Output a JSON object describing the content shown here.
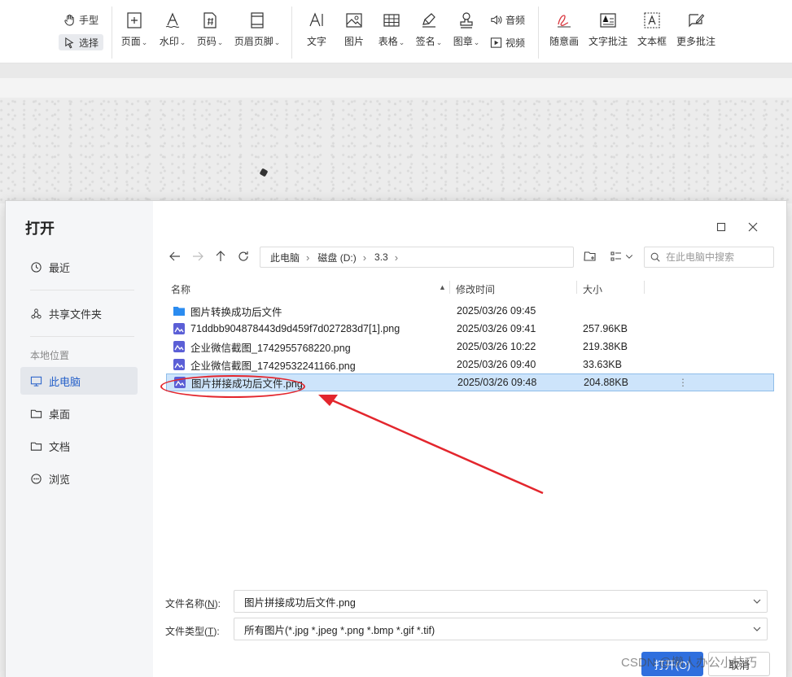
{
  "toolbar": {
    "hand_label": "手型",
    "select_label": "选择",
    "page_label": "页面",
    "watermark_label": "水印",
    "pagenum_label": "页码",
    "headerfooter_label": "页眉页脚",
    "text_label": "文字",
    "image_label": "图片",
    "table_label": "表格",
    "sign_label": "签名",
    "stamp_label": "图章",
    "audio_label": "音频",
    "video_label": "视频",
    "freehand_label": "随意画",
    "textnote_label": "文字批注",
    "textbox_label": "文本框",
    "morenote_label": "更多批注"
  },
  "dialog": {
    "title": "打开",
    "sidebar": {
      "recent": "最近",
      "shared": "共享文件夹",
      "local_section": "本地位置",
      "this_pc": "此电脑",
      "desktop": "桌面",
      "documents": "文档",
      "browse": "浏览"
    },
    "breadcrumb": [
      "此电脑",
      "磁盘 (D:)",
      "3.3"
    ],
    "search_placeholder": "在此电脑中搜索",
    "columns": {
      "name": "名称",
      "modified": "修改时间",
      "size": "大小"
    },
    "files": [
      {
        "name": "图片转换成功后文件",
        "date": "2025/03/26 09:45",
        "size": "",
        "type": "folder"
      },
      {
        "name": "71ddbb904878443d9d459f7d027283d7[1].png",
        "date": "2025/03/26 09:41",
        "size": "257.96KB",
        "type": "image"
      },
      {
        "name": "企业微信截图_1742955768220.png",
        "date": "2025/03/26 10:22",
        "size": "219.38KB",
        "type": "image"
      },
      {
        "name": "企业微信截图_17429532241166.png",
        "date": "2025/03/26 09:40",
        "size": "33.63KB",
        "type": "image"
      },
      {
        "name": "图片拼接成功后文件.png",
        "date": "2025/03/26 09:48",
        "size": "204.88KB",
        "type": "image",
        "selected": true
      }
    ],
    "more_icon_text": "⋮",
    "filename_label": "文件名称(",
    "filename_key": "N",
    "filename_label_end": "):",
    "filename_value": "图片拼接成功后文件.png",
    "filetype_label": "文件类型(",
    "filetype_key": "T",
    "filetype_label_end": "):",
    "filetype_value": "所有图片(*.jpg *.jpeg *.png *.bmp *.gif *.tif)",
    "open_button": "打开(O)",
    "cancel_button": "取消"
  },
  "watermark": "CSDN @懒人办公小技巧",
  "colors": {
    "accent": "#2f6fde",
    "selection": "#cde4fb",
    "annotation": "#e3262d"
  }
}
